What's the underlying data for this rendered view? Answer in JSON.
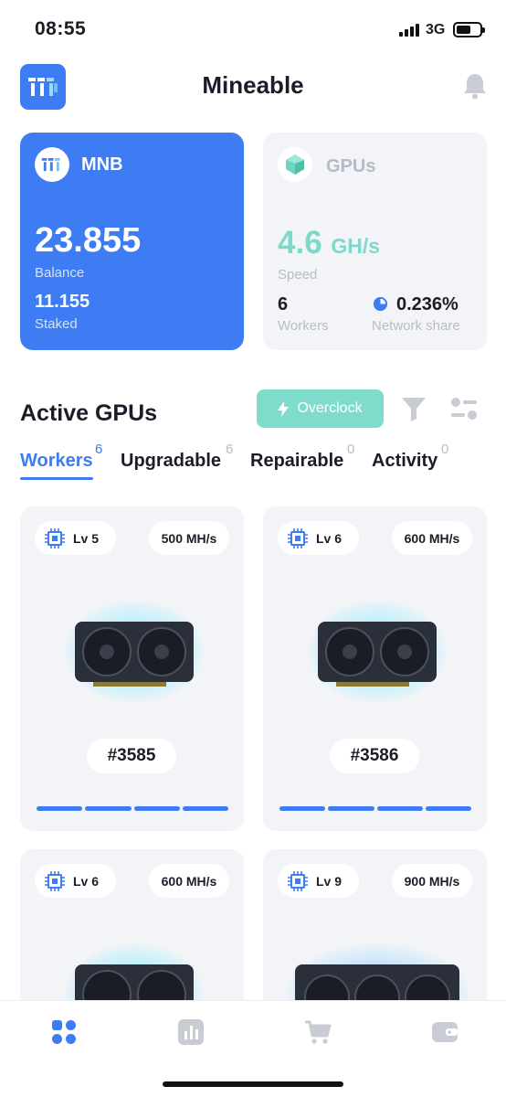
{
  "status_bar": {
    "time": "08:55",
    "network": "3G"
  },
  "header": {
    "title": "Mineable"
  },
  "mnb_card": {
    "token": "MNB",
    "balance_value": "23.855",
    "balance_label": "Balance",
    "staked_value": "11.155",
    "staked_label": "Staked"
  },
  "gpus_card": {
    "title": "GPUs",
    "speed_value": "4.6",
    "speed_unit": "GH/s",
    "speed_label": "Speed",
    "workers_value": "6",
    "workers_label": "Workers",
    "share_value": "0.236%",
    "share_label": "Network share"
  },
  "section": {
    "title": "Active GPUs",
    "overclock_label": "Overclock"
  },
  "tabs": [
    {
      "label": "Workers",
      "count": "6"
    },
    {
      "label": "Upgradable",
      "count": "6"
    },
    {
      "label": "Repairable",
      "count": "0"
    },
    {
      "label": "Activity",
      "count": "0"
    }
  ],
  "gpus": [
    {
      "level": "Lv 5",
      "hashrate": "500 MH/s",
      "id": "#3585"
    },
    {
      "level": "Lv 6",
      "hashrate": "600 MH/s",
      "id": "#3586"
    },
    {
      "level": "Lv 6",
      "hashrate": "600 MH/s",
      "id": ""
    },
    {
      "level": "Lv 9",
      "hashrate": "900 MH/s",
      "id": ""
    }
  ],
  "colors": {
    "accent": "#3d7cf2",
    "teal": "#7fdccd",
    "card_bg": "#f3f4f8",
    "muted": "#b8bcc7"
  },
  "nav_icons": [
    "dashboard-icon",
    "stats-icon",
    "cart-icon",
    "wallet-icon"
  ]
}
